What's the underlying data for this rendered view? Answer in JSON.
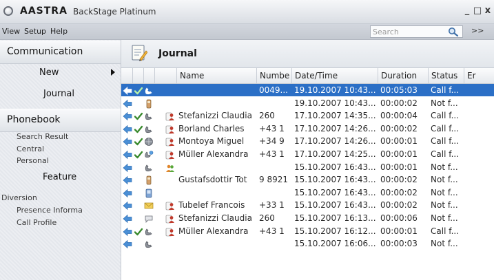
{
  "window": {
    "brand": "AASTRA",
    "app_name": "BackStage Platinum",
    "minimize_label": "_",
    "restore_label": "□",
    "close_label": "x"
  },
  "menu": {
    "items": [
      "View",
      "Setup",
      "Help"
    ]
  },
  "search": {
    "placeholder": "Search",
    "more_label": ">>"
  },
  "sidebar": {
    "communication": "Communication",
    "new": "New",
    "journal": "Journal",
    "phonebook": "Phonebook",
    "phonebook_items": [
      "Search Result",
      "Central",
      "Personal"
    ],
    "feature": "Feature",
    "feature_items": [
      "Diversion",
      "Presence Informa",
      "Call Profile"
    ]
  },
  "main": {
    "title": "Journal"
  },
  "table": {
    "headers": {
      "name": "Name",
      "number": "Numbe",
      "datetime": "Date/Time",
      "duration": "Duration",
      "status": "Status",
      "extra": "Er"
    },
    "rows": [
      {
        "dir": "in",
        "ok": true,
        "type": "handset",
        "contact": false,
        "name": "",
        "number": "0049...",
        "datetime": "19.10.2007 10:43...",
        "duration": "00:05:03",
        "status": "Call f..."
      },
      {
        "dir": "in",
        "ok": false,
        "type": "mobile",
        "contact": false,
        "name": "",
        "number": "",
        "datetime": "19.10.2007 10:43...",
        "duration": "00:00:02",
        "status": "Not f..."
      },
      {
        "dir": "in",
        "ok": true,
        "type": "handset",
        "contact": true,
        "name": "Stefanizzi Claudia",
        "number": "260",
        "datetime": "17.10.2007 14:35...",
        "duration": "00:00:04",
        "status": "Call f..."
      },
      {
        "dir": "in",
        "ok": true,
        "type": "handset",
        "contact": true,
        "name": "Borland Charles",
        "number": "+43 1",
        "datetime": "17.10.2007 14:26...",
        "duration": "00:00:02",
        "status": "Call f..."
      },
      {
        "dir": "in",
        "ok": true,
        "type": "globe",
        "contact": true,
        "name": "Montoya Miguel",
        "number": "+34 9",
        "datetime": "17.10.2007 14:26...",
        "duration": "00:00:01",
        "status": "Call f..."
      },
      {
        "dir": "in",
        "ok": true,
        "type": "multi",
        "contact": true,
        "name": "Müller Alexandra",
        "number": "+43 1",
        "datetime": "17.10.2007 14:25...",
        "duration": "00:00:01",
        "status": "Call f..."
      },
      {
        "dir": "in",
        "ok": false,
        "type": "handset",
        "contact": "group",
        "name": "",
        "number": "",
        "datetime": "15.10.2007 16:43...",
        "duration": "00:00:01",
        "status": "Not f..."
      },
      {
        "dir": "in",
        "ok": false,
        "type": "mobile",
        "contact": false,
        "name": "Gustafsdottir Tot",
        "number": "9 8921",
        "datetime": "15.10.2007 16:43...",
        "duration": "00:00:02",
        "status": "Not f..."
      },
      {
        "dir": "in",
        "ok": false,
        "type": "pda",
        "contact": false,
        "name": "",
        "number": "",
        "datetime": "15.10.2007 16:43...",
        "duration": "00:00:02",
        "status": "Not f..."
      },
      {
        "dir": "in",
        "ok": false,
        "type": "mail",
        "contact": true,
        "name": "Tubelef Francois",
        "number": "+33 1",
        "datetime": "15.10.2007 16:43...",
        "duration": "00:00:02",
        "status": "Not f..."
      },
      {
        "dir": "in",
        "ok": false,
        "type": "chat",
        "contact": true,
        "name": "Stefanizzi Claudia",
        "number": "260",
        "datetime": "15.10.2007 16:13...",
        "duration": "00:00:06",
        "status": "Not f..."
      },
      {
        "dir": "in",
        "ok": true,
        "type": "handset",
        "contact": true,
        "name": "Müller Alexandra",
        "number": "+43 1",
        "datetime": "15.10.2007 16:12...",
        "duration": "00:00:01",
        "status": "Call f..."
      },
      {
        "dir": "in",
        "ok": false,
        "type": "handset",
        "contact": false,
        "name": "",
        "number": "",
        "datetime": "15.10.2007 16:06...",
        "duration": "00:00:03",
        "status": "Not f..."
      }
    ]
  },
  "colors": {
    "selection": "#2b6fc6",
    "arrow": "#4a8fd6",
    "check": "#3a8a2e",
    "contact": "#c0392b"
  }
}
